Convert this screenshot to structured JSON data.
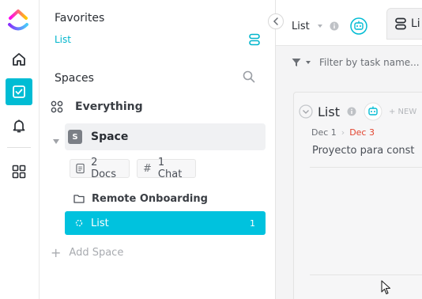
{
  "rail": {
    "icons": [
      "clickup-logo-icon",
      "home-icon",
      "my-work-icon",
      "notifications-icon",
      "apps-icon"
    ],
    "accent": "#00bcd4"
  },
  "sidebar": {
    "favorites_title": "Favorites",
    "favorites_list": "List",
    "spaces_title": "Spaces",
    "everything": "Everything",
    "space_badge": "S",
    "space_name": "Space",
    "docs_chip": "2 Docs",
    "chat_chip": "1 Chat",
    "folder_name": "Remote Onboarding",
    "list_name": "List",
    "list_count": "1",
    "add_space": "Add Space",
    "accent": "#00c2de"
  },
  "main": {
    "tab1_label": "List",
    "tab2_label": "Li",
    "filter_placeholder": "Filter by task name...",
    "list_title": "List",
    "new_label": "+ NEW",
    "start_date": "Dec 1",
    "due_date": "Dec 3",
    "description": "Proyecto para const",
    "due_color": "#e2442f"
  }
}
